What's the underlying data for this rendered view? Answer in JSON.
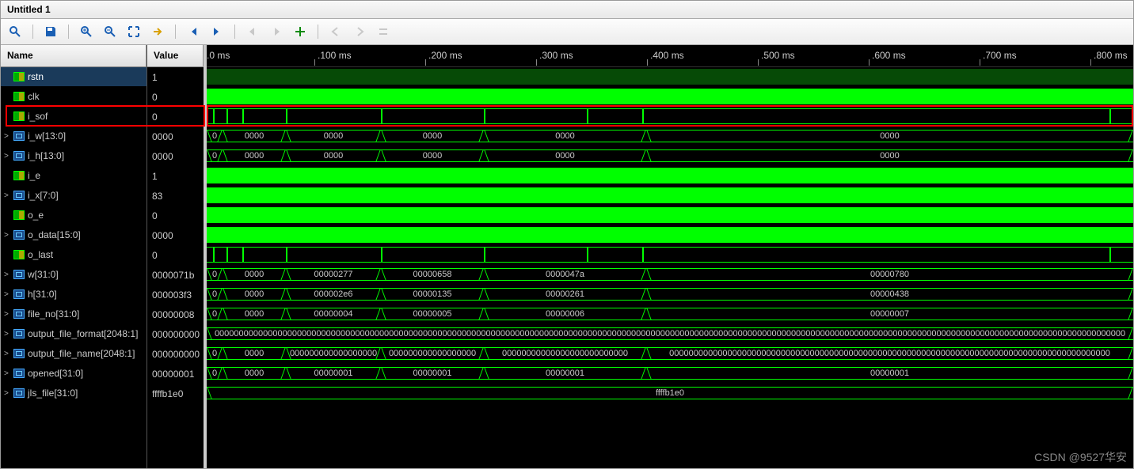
{
  "title": "Untitled 1",
  "toolbar": {
    "icons": [
      "search",
      "save",
      "zoom-in",
      "zoom-out",
      "fit",
      "goto",
      "first",
      "last",
      "undo",
      "redo",
      "add-marker",
      "prev-edge",
      "next-edge",
      "swap"
    ]
  },
  "headers": {
    "name": "Name",
    "value": "Value"
  },
  "signals": [
    {
      "name": "rstn",
      "value": "1",
      "type": "sig",
      "exp": "",
      "sel": true
    },
    {
      "name": "clk",
      "value": "0",
      "type": "sig",
      "exp": ""
    },
    {
      "name": "i_sof",
      "value": "0",
      "type": "sig",
      "exp": ""
    },
    {
      "name": "i_w[13:0]",
      "value": "0000",
      "type": "bus",
      "exp": ">"
    },
    {
      "name": "i_h[13:0]",
      "value": "0000",
      "type": "bus",
      "exp": ">"
    },
    {
      "name": "i_e",
      "value": "1",
      "type": "sig",
      "exp": ""
    },
    {
      "name": "i_x[7:0]",
      "value": "83",
      "type": "bus",
      "exp": ">"
    },
    {
      "name": "o_e",
      "value": "0",
      "type": "sig",
      "exp": ""
    },
    {
      "name": "o_data[15:0]",
      "value": "0000",
      "type": "bus",
      "exp": ">"
    },
    {
      "name": "o_last",
      "value": "0",
      "type": "sig",
      "exp": ""
    },
    {
      "name": "w[31:0]",
      "value": "0000071b",
      "type": "bus",
      "exp": ">"
    },
    {
      "name": "h[31:0]",
      "value": "000003f3",
      "type": "bus",
      "exp": ">"
    },
    {
      "name": "file_no[31:0]",
      "value": "00000008",
      "type": "bus",
      "exp": ">"
    },
    {
      "name": "output_file_format[2048:1]",
      "value": "000000000",
      "type": "bus",
      "exp": ">"
    },
    {
      "name": "output_file_name[2048:1]",
      "value": "000000000",
      "type": "bus",
      "exp": ">"
    },
    {
      "name": "opened[31:0]",
      "value": "00000001",
      "type": "bus",
      "exp": ">"
    },
    {
      "name": "jls_file[31:0]",
      "value": "ffffb1e0",
      "type": "bus",
      "exp": ">"
    }
  ],
  "ruler": [
    {
      "pos": 0,
      "label": ".0 ms"
    },
    {
      "pos": 140,
      "label": ".100 ms"
    },
    {
      "pos": 280,
      "label": ".200 ms"
    },
    {
      "pos": 420,
      "label": ".300 ms"
    },
    {
      "pos": 560,
      "label": ".400 ms"
    },
    {
      "pos": 700,
      "label": ".500 ms"
    },
    {
      "pos": 840,
      "label": ".600 ms"
    },
    {
      "pos": 980,
      "label": ".700 ms"
    },
    {
      "pos": 1120,
      "label": ".800 ms"
    }
  ],
  "waves": {
    "rstn": {
      "kind": "fill",
      "cls": "dk"
    },
    "clk": {
      "kind": "fill",
      "cls": ""
    },
    "i_sof": {
      "kind": "pulses",
      "at": [
        8,
        25,
        45,
        100,
        220,
        350,
        480,
        550,
        1140
      ]
    },
    "i_w": {
      "kind": "bus",
      "segs": [
        [
          0,
          20,
          "0"
        ],
        [
          20,
          100,
          "0000"
        ],
        [
          100,
          220,
          "0000"
        ],
        [
          220,
          350,
          "0000"
        ],
        [
          350,
          555,
          "0000"
        ],
        [
          555,
          1170,
          "0000"
        ]
      ]
    },
    "i_h": {
      "kind": "bus",
      "segs": [
        [
          0,
          20,
          "0"
        ],
        [
          20,
          100,
          "0000"
        ],
        [
          100,
          220,
          "0000"
        ],
        [
          220,
          350,
          "0000"
        ],
        [
          350,
          555,
          "0000"
        ],
        [
          555,
          1170,
          "0000"
        ]
      ]
    },
    "i_e": {
      "kind": "fill",
      "cls": ""
    },
    "i_x": {
      "kind": "fill",
      "cls": ""
    },
    "o_e": {
      "kind": "fill",
      "cls": ""
    },
    "o_data": {
      "kind": "fill",
      "cls": ""
    },
    "o_last": {
      "kind": "pulses",
      "at": [
        8,
        25,
        45,
        100,
        220,
        350,
        480,
        550,
        1140
      ]
    },
    "w": {
      "kind": "bus",
      "segs": [
        [
          0,
          20,
          "0"
        ],
        [
          20,
          100,
          "0000"
        ],
        [
          100,
          220,
          "00000277"
        ],
        [
          220,
          350,
          "00000658"
        ],
        [
          350,
          555,
          "0000047a"
        ],
        [
          555,
          1170,
          "00000780"
        ]
      ]
    },
    "h": {
      "kind": "bus",
      "segs": [
        [
          0,
          20,
          "0"
        ],
        [
          20,
          100,
          "0000"
        ],
        [
          100,
          220,
          "000002e6"
        ],
        [
          220,
          350,
          "00000135"
        ],
        [
          350,
          555,
          "00000261"
        ],
        [
          555,
          1170,
          "00000438"
        ]
      ]
    },
    "file_no": {
      "kind": "bus",
      "segs": [
        [
          0,
          20,
          "0"
        ],
        [
          20,
          100,
          "0000"
        ],
        [
          100,
          220,
          "00000004"
        ],
        [
          220,
          350,
          "00000005"
        ],
        [
          350,
          555,
          "00000006"
        ],
        [
          555,
          1170,
          "00000007"
        ]
      ]
    },
    "output_file_format": {
      "kind": "bus",
      "segs": [
        [
          0,
          1170,
          "00000000000000000000000000000000000000000000000000000000000000000000000000000000000000000000000000000000000000000000000000000000000000000000000000000000000000000000000000000000000000000000"
        ]
      ]
    },
    "output_file_name": {
      "kind": "bus",
      "segs": [
        [
          0,
          20,
          "0"
        ],
        [
          20,
          100,
          "0000"
        ],
        [
          100,
          220,
          "000000000000000000"
        ],
        [
          220,
          350,
          "000000000000000000"
        ],
        [
          350,
          555,
          "00000000000000000000000000"
        ],
        [
          555,
          1170,
          "0000000000000000000000000000000000000000000000000000000000000000000000000000000000000000000"
        ]
      ]
    },
    "opened": {
      "kind": "bus",
      "segs": [
        [
          0,
          20,
          "0"
        ],
        [
          20,
          100,
          "0000"
        ],
        [
          100,
          220,
          "00000001"
        ],
        [
          220,
          350,
          "00000001"
        ],
        [
          350,
          555,
          "00000001"
        ],
        [
          555,
          1170,
          "00000001"
        ]
      ]
    },
    "jls_file": {
      "kind": "bus",
      "segs": [
        [
          0,
          1170,
          "ffffb1e0"
        ]
      ]
    }
  },
  "watermark": "CSDN @9527华安"
}
